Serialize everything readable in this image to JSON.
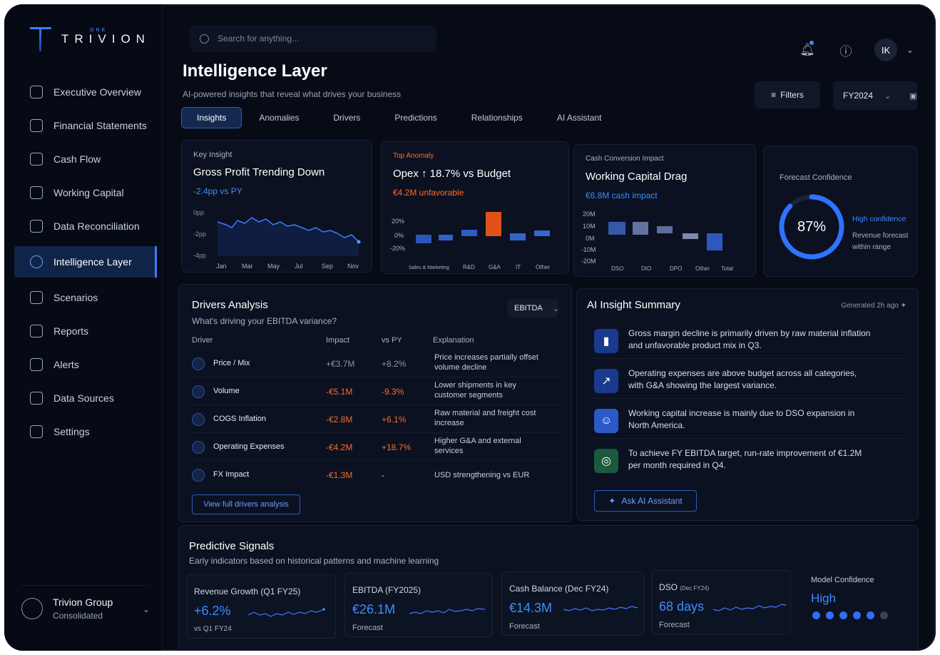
{
  "brand": {
    "name": "TRIVION",
    "sub": "ONE"
  },
  "sidebar": {
    "items": [
      {
        "label": "Executive Overview",
        "icon": "grid-icon"
      },
      {
        "label": "Financial Statements",
        "icon": "document-icon"
      },
      {
        "label": "Cash Flow",
        "icon": "cash-icon"
      },
      {
        "label": "Working Capital",
        "icon": "wallet-icon"
      },
      {
        "label": "Data Reconciliation",
        "icon": "reconcile-icon"
      },
      {
        "label": "Intelligence Layer",
        "icon": "brain-icon",
        "active": true
      },
      {
        "label": "Scenarios",
        "icon": "scenario-icon"
      },
      {
        "label": "Reports",
        "icon": "report-icon"
      },
      {
        "label": "Alerts",
        "icon": "bell-icon"
      },
      {
        "label": "Data Sources",
        "icon": "database-icon"
      },
      {
        "label": "Settings",
        "icon": "gear-icon"
      }
    ],
    "org": {
      "name": "Trivion Group",
      "sub": "Consolidated"
    }
  },
  "search": {
    "placeholder": "Search for anything..."
  },
  "user": {
    "initials": "IK"
  },
  "page": {
    "title": "Intelligence Layer",
    "subtitle": "AI-powered insights that reveal what drives your business",
    "filters": "Filters",
    "fy": "FY2024"
  },
  "tabs": [
    "Insights",
    "Anomalies",
    "Drivers",
    "Predictions",
    "Relationships",
    "AI Assistant"
  ],
  "kpis": {
    "insight": {
      "label": "Key Insight",
      "title": "Gross Profit Trending Down",
      "value": "-2.4pp vs PY",
      "yticks": [
        "0pp",
        "-2pp",
        "-4pp"
      ],
      "xticks": [
        "Jan",
        "Mar",
        "May",
        "Jul",
        "Sep",
        "Nov"
      ]
    },
    "anomaly": {
      "label": "Top Anomaly",
      "title": "Opex ↑ 18.7% vs Budget",
      "value": "€4.2M unfavorable",
      "yticks": [
        "20%",
        "0%",
        "-20%"
      ],
      "xticks": [
        "Sales & Marketing",
        "R&D",
        "G&A",
        "IT",
        "Other"
      ]
    },
    "cash": {
      "label": "Cash Conversion Impact",
      "title": "Working Capital Drag",
      "value": "€6.8M cash impact",
      "yticks": [
        "20M",
        "10M",
        "0M",
        "-10M",
        "-20M"
      ],
      "xticks": [
        "DSO",
        "DIO",
        "DPO",
        "Other",
        "Total"
      ]
    },
    "forecast": {
      "label": "Forecast Confidence",
      "value": "87%",
      "level": 0.87,
      "confidence": "High confidence",
      "note": "Revenue forecast within range"
    }
  },
  "drivers": {
    "title": "Drivers Analysis",
    "subtitle": "What's driving your EBITDA variance?",
    "metric": "EBITDA",
    "columns": [
      "Driver",
      "Impact",
      "vs PY",
      "Explanation"
    ],
    "rows": [
      {
        "name": "Price / Mix",
        "impact": "+€3.7M",
        "pct": "+8.2%",
        "exp": "Price increases partially offset volume decline",
        "tone": "muted"
      },
      {
        "name": "Volume",
        "impact": "-€5.1M",
        "pct": "-9.3%",
        "exp": "Lower shipments in key customer segments",
        "tone": "orange"
      },
      {
        "name": "COGS Inflation",
        "impact": "-€2.8M",
        "pct": "+6.1%",
        "exp": "Raw material and freight cost increase",
        "tone": "orange"
      },
      {
        "name": "Operating Expenses",
        "impact": "-€4.2M",
        "pct": "+18.7%",
        "exp": "Higher G&A and external services",
        "tone": "orange"
      },
      {
        "name": "FX Impact",
        "impact": "-€1.3M",
        "pct": "-",
        "exp": "USD strengthening vs EUR",
        "tone": "orange"
      }
    ],
    "button": "View full drivers analysis"
  },
  "ai": {
    "title": "AI Insight Summary",
    "generated": "Generated 2h ago",
    "items": [
      "Gross margin decline is primarily driven by raw material inflation and unfavorable product mix in Q3.",
      "Operating expenses are above budget across all categories, with G&A showing the largest variance.",
      "Working capital increase is mainly due to DSO expansion in North America.",
      "To achieve FY EBITDA target, run-rate improvement of €1.2M per month required in Q4."
    ],
    "button": "Ask AI Assistant"
  },
  "predictive": {
    "title": "Predictive Signals",
    "subtitle": "Early indicators based on historical patterns and machine learning",
    "cards": [
      {
        "label": "Revenue Growth (Q1 FY25)",
        "value": "+6.2%",
        "foot": "vs Q1 FY24"
      },
      {
        "label": "EBITDA (FY2025)",
        "value": "€26.1M",
        "foot": "Forecast"
      },
      {
        "label": "Cash Balance (Dec FY24)",
        "value": "€14.3M",
        "foot": "Forecast"
      },
      {
        "label": "DSO",
        "label2": "(Dec FY24)",
        "value": "68 days",
        "foot": "Forecast"
      }
    ],
    "model": {
      "label": "Model Confidence",
      "value": "High",
      "level": 5,
      "max": 6
    }
  }
}
